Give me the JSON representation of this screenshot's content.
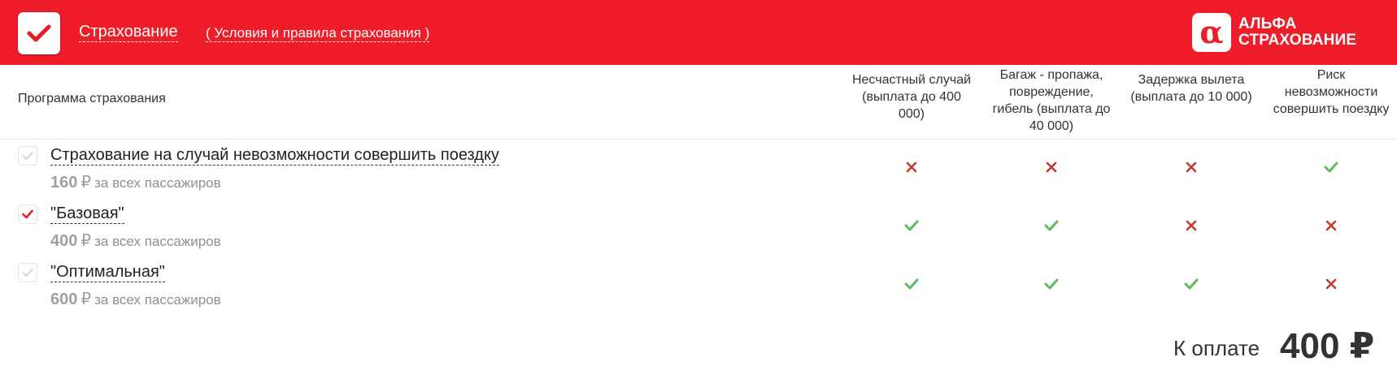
{
  "header": {
    "title": "Страхование",
    "terms_link": "( Условия и правила страхования )",
    "logo_line1": "АЛЬФА",
    "logo_line2": "СТРАХОВАНИЕ",
    "brand_color": "#ef1c29"
  },
  "table": {
    "program_header": "Программа страхования",
    "columns": [
      "Несчастный случай (выплата до 400 000)",
      "Багаж - пропажа, повреждение, гибель (выплата до 40 000)",
      "Задержка вылета (выплата до 10 000)",
      "Риск невозможности совершить поездку"
    ],
    "rows": [
      {
        "title": "Страхование на случай невозможности совершить поездку",
        "price": "160",
        "currency": "₽",
        "note": "за всех пассажиров",
        "selected": false,
        "coverage": [
          "cross-icon",
          "cross-icon",
          "cross-icon",
          "check-icon"
        ]
      },
      {
        "title": "\"Базовая\"",
        "price": "400",
        "currency": "₽",
        "note": "за всех пассажиров",
        "selected": true,
        "coverage": [
          "check-icon",
          "check-icon",
          "cross-icon",
          "cross-icon"
        ]
      },
      {
        "title": "\"Оптимальная\"",
        "price": "600",
        "currency": "₽",
        "note": "за всех пассажиров",
        "selected": false,
        "coverage": [
          "check-icon",
          "check-icon",
          "check-icon",
          "cross-icon"
        ]
      }
    ]
  },
  "total": {
    "label": "К оплате",
    "value": "400 ₽"
  },
  "colors": {
    "check_green": "#5cb85c",
    "cross_red": "#c0392b",
    "selected_check": "#e31e24"
  }
}
